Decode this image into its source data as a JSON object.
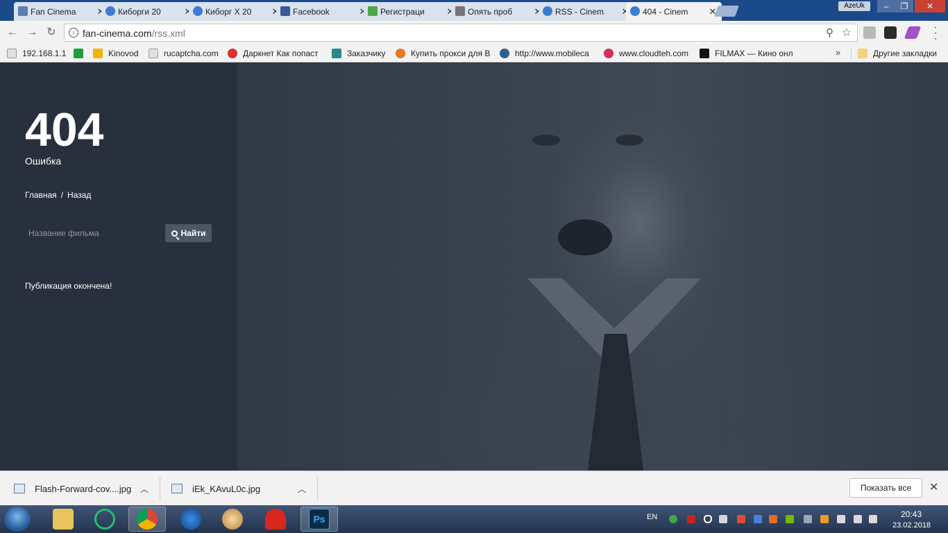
{
  "browser": {
    "tabs": [
      {
        "title": "Fan Cinema",
        "favicon_color": "#5b7fb0"
      },
      {
        "title": "Киборги 20",
        "favicon_color": "#3d7bd3"
      },
      {
        "title": "Киборг Х 20",
        "favicon_color": "#3d7bd3"
      },
      {
        "title": "Facebook",
        "favicon_color": "#3b5998"
      },
      {
        "title": "Регистраци",
        "favicon_color": "#4ca64c"
      },
      {
        "title": "Опять проб",
        "favicon_color": "#777777"
      },
      {
        "title": "RSS - Cinem",
        "favicon_color": "#3d7bd3"
      },
      {
        "title": "404 - Cinem",
        "favicon_color": "#3d7bd3"
      }
    ],
    "active_tab_index": 7,
    "profile_name": "AzeUk",
    "url_host": "fan-cinema.com",
    "url_path": "/rss.xml",
    "bookmarks": [
      {
        "label": "192.168.1.1",
        "icon_color": "#cccccc"
      },
      {
        "label": "",
        "icon_color": "#1e9e3e"
      },
      {
        "label": "Kinovod",
        "icon_color": "#f0b400"
      },
      {
        "label": "rucaptcha.com",
        "icon_color": "#cccccc"
      },
      {
        "label": "Даркнет Как попаст",
        "icon_color": "#d9302c"
      },
      {
        "label": "Заказчику",
        "icon_color": "#2a8a8a"
      },
      {
        "label": "Купить прокси для В",
        "icon_color": "#e8771e"
      },
      {
        "label": "http://www.mobileca",
        "icon_color": "#2d5f8a"
      },
      {
        "label": "www.cloudteh.com",
        "icon_color": "#d0315b"
      },
      {
        "label": "FILMAX — Кино онл",
        "icon_color": "#111111"
      }
    ],
    "other_bookmarks": "Другие закладки",
    "more_bookmarks": "»"
  },
  "page": {
    "error_code": "404",
    "error_text": "Ошибка",
    "breadcrumb_home": "Главная",
    "breadcrumb_separator": "/",
    "breadcrumb_back": "Назад",
    "search_placeholder": "Название фильма",
    "search_button": "Найти",
    "publication_status": "Публикация окончена!"
  },
  "downloads": {
    "items": [
      {
        "filename": "Flash-Forward-cov....jpg"
      },
      {
        "filename": "iEk_KAvuL0c.jpg"
      }
    ],
    "show_all": "Показать все"
  },
  "taskbar": {
    "language": "EN",
    "time": "20:43",
    "date": "23.02.2018"
  }
}
